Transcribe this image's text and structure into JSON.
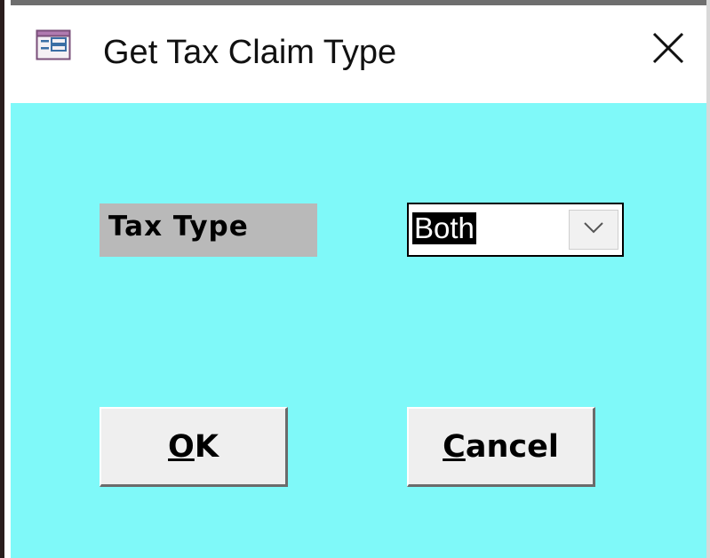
{
  "window": {
    "title": "Get Tax Claim Type",
    "icon": "form-icon",
    "close_icon": "close-icon"
  },
  "form": {
    "tax_type_label": "Tax Type",
    "tax_type_value": "Both",
    "dropdown_icon": "chevron-down-icon"
  },
  "buttons": {
    "ok": {
      "mnemonic": "O",
      "rest": "K"
    },
    "cancel": {
      "mnemonic": "C",
      "rest": "ancel"
    }
  },
  "colors": {
    "client_background": "#7ff9f9",
    "label_background": "#b9b9b9",
    "selection_background": "#000000",
    "selection_text": "#ffffff"
  }
}
